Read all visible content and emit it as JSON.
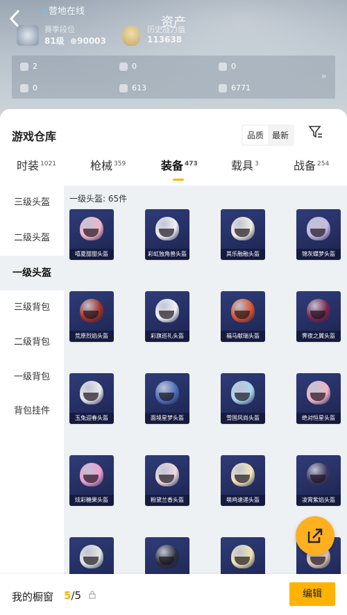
{
  "header": {
    "title": "资产",
    "online_status": "营地在线",
    "rank_caption": "赛季段位",
    "rank_level": "81级",
    "rank_points": "90003",
    "power_caption": "历史战力值",
    "power_value": "113638"
  },
  "resources": [
    {
      "icon": "ticket-icon",
      "value": "2"
    },
    {
      "icon": "coin-icon",
      "value": "0"
    },
    {
      "icon": "gold-coin-icon",
      "value": "0"
    },
    {
      "icon": "card-icon",
      "value": "0"
    },
    {
      "icon": "gem-icon",
      "value": "613"
    },
    {
      "icon": "medal-icon",
      "value": "6771"
    }
  ],
  "warehouse": {
    "title": "游戏仓库",
    "sort_options": [
      "品质",
      "最新"
    ],
    "tabs": [
      {
        "label": "时装",
        "count": "1021"
      },
      {
        "label": "枪械",
        "count": "359"
      },
      {
        "label": "装备",
        "count": "473"
      },
      {
        "label": "载具",
        "count": "3"
      },
      {
        "label": "战备",
        "count": "254"
      }
    ],
    "active_tab": "装备",
    "categories": [
      "三级头盔",
      "二级头盔",
      "一级头盔",
      "三级背包",
      "二级背包",
      "一级背包",
      "背包挂件"
    ],
    "active_category": "一级头盔",
    "section_caption": "一级头盔: 65件",
    "items": [
      {
        "name": "嘻夏甜甜头盔",
        "color": "#f4b6c8"
      },
      {
        "name": "彩虹独角兽头盔",
        "color": "#f1f1f4"
      },
      {
        "name": "其乐融融头盔",
        "color": "#f3efe3"
      },
      {
        "name": "锦灰蝶梦头盔",
        "color": "#c8b8e6"
      },
      {
        "name": "荒原烈焰头盔",
        "color": "#a33226"
      },
      {
        "name": "彩旗巡礼头盔",
        "color": "#f2f2f7"
      },
      {
        "name": "福马献瑞头盔",
        "color": "#d9532b"
      },
      {
        "name": "霁夜之翼头盔",
        "color": "#7a2450"
      },
      {
        "name": "玉兔迎春头盔",
        "color": "#e9e9ee"
      },
      {
        "name": "面境星梦头盔",
        "color": "#4b6fb8"
      },
      {
        "name": "雪国风尚头盔",
        "color": "#a9d6f2"
      },
      {
        "name": "绝对恒星头盔",
        "color": "#f1b4c9"
      },
      {
        "name": "炫彩糖果头盔",
        "color": "#ef9fd0"
      },
      {
        "name": "粉黛兰香头盔",
        "color": "#eed9df"
      },
      {
        "name": "萌鸡速递头盔",
        "color": "#f5e6b6"
      },
      {
        "name": "凌霄紫焰头盔",
        "color": "#3a3560"
      },
      {
        "name": "",
        "color": "#dfe9e2"
      },
      {
        "name": "",
        "color": "#2b2f3b"
      },
      {
        "name": "",
        "color": "#f2e4b0"
      },
      {
        "name": "",
        "color": "#e2c7b6"
      }
    ]
  },
  "footer": {
    "label": "我的橱窗",
    "current": "5",
    "separator": "/",
    "total": "5",
    "edit_label": "编辑"
  },
  "colors": {
    "accent": "#ffb300",
    "card_bg": "#2a3470"
  }
}
